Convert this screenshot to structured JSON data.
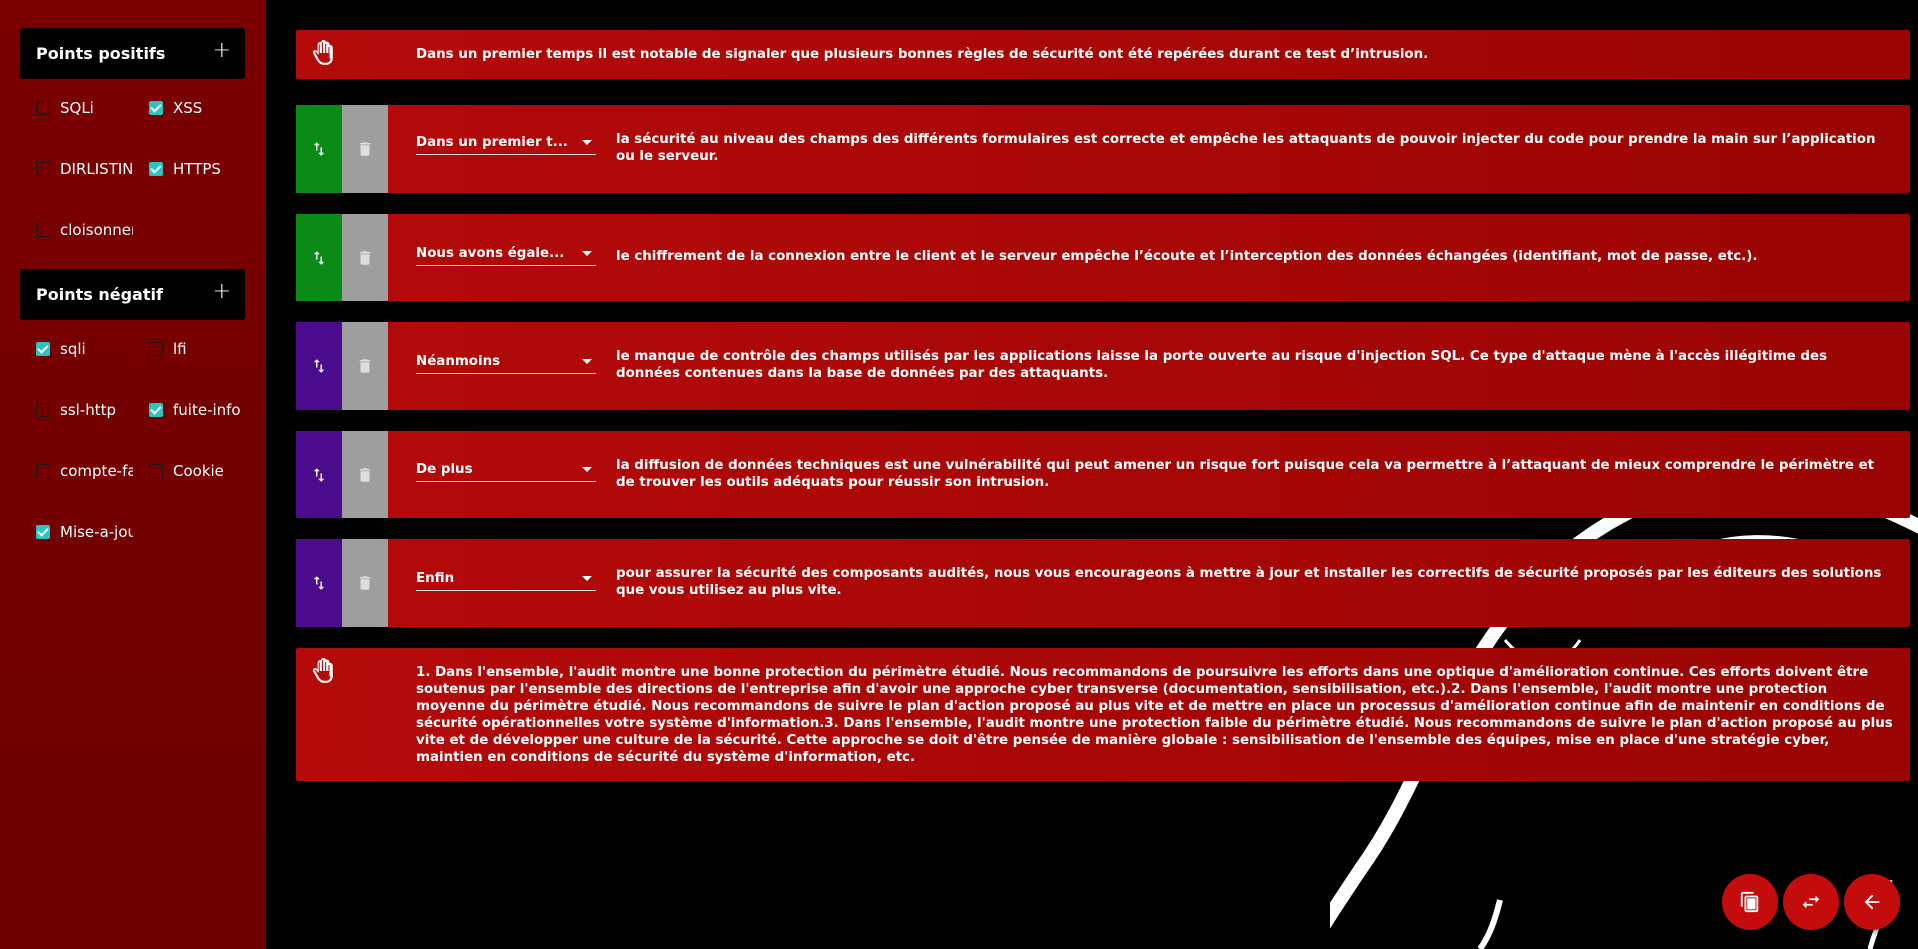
{
  "sidebar": {
    "positive": {
      "title": "Points positifs",
      "add_label": "+",
      "items": [
        {
          "label": "SQLi",
          "checked": false
        },
        {
          "label": "XSS",
          "checked": true
        },
        {
          "label": "DIRLISTING",
          "checked": false
        },
        {
          "label": "HTTPS",
          "checked": true
        },
        {
          "label": "cloisonnement",
          "checked": false
        }
      ]
    },
    "negative": {
      "title": "Points négatif",
      "add_label": "+",
      "items": [
        {
          "label": "sqli",
          "checked": true
        },
        {
          "label": "lfi",
          "checked": false
        },
        {
          "label": "ssl-http",
          "checked": false
        },
        {
          "label": "fuite-info",
          "checked": true
        },
        {
          "label": "compte-faible",
          "checked": false
        },
        {
          "label": "Cookie",
          "checked": false
        },
        {
          "label": "Mise-a-jour",
          "checked": true
        }
      ]
    }
  },
  "main": {
    "intro": "Dans un premier temps il est notable de signaler que plusieurs bonnes règles de sécurité ont été repérées durant ce test d’intrusion.",
    "rows": [
      {
        "connector": "Dans un premier temps",
        "connector_display": "Dans un premier t...",
        "text": "la sécurité au niveau des champs des différents formulaires est correcte et empêche les attaquants de pouvoir injecter du code pour prendre la main sur l’application ou le serveur.",
        "kind": "positive"
      },
      {
        "connector": "Nous avons également",
        "connector_display": "Nous avons égale...",
        "text": "le chiffrement de la connexion entre le client et le serveur empêche l’écoute et l’interception des données échangées (identifiant, mot de passe, etc.).",
        "kind": "positive"
      },
      {
        "connector": "Néanmoins",
        "connector_display": "Néanmoins",
        "text": "le manque de contrôle des champs utilisés par les applications laisse la porte ouverte au risque d'injection SQL. Ce type d'attaque mène à l'accès illégitime des données contenues dans la base de données par des attaquants.",
        "kind": "negative"
      },
      {
        "connector": "De plus",
        "connector_display": "De plus",
        "text": "la diffusion de données techniques est une vulnérabilité qui peut amener un risque fort puisque cela va permettre à l’attaquant de mieux comprendre le périmètre et de trouver les outils adéquats pour réussir son intrusion.",
        "kind": "negative"
      },
      {
        "connector": "Enfin",
        "connector_display": "Enfin",
        "text": "pour assurer la sécurité des composants audités, nous vous encourageons à mettre à jour et installer les correctifs de sécurité proposés par les éditeurs des solutions que vous utilisez au plus vite.",
        "kind": "negative"
      }
    ],
    "conclusion": "1. Dans l'ensemble, l'audit montre une bonne protection du périmètre étudié. Nous recommandons de poursuivre les efforts dans une optique d'amélioration continue. Ces efforts doivent être soutenus par l'ensemble des directions de l'entreprise afin d'avoir une approche cyber transverse (documentation, sensibilisation, etc.).2. Dans l'ensemble, l'audit montre une protection moyenne du périmètre étudié. Nous recommandons de suivre le plan d'action proposé au plus vite et de mettre en place un processus d'amélioration continue afin de maintenir en conditions de sécurité opérationnelles votre système d'information.3. Dans l'ensemble, l'audit montre une protection faible du périmètre étudié. Nous recommandons de suivre le plan d'action proposé au plus vite et de développer une culture de la sécurité. Cette approche se doit d'être pensée de manière globale : sensibilisation de l'ensemble des équipes, mise en place d'une stratégie cyber, maintien en conditions de sécurité du système d'information, etc."
  },
  "colors": {
    "positive": "#0b8a17",
    "negative": "#4a0c8c",
    "delete": "#9e9e9e",
    "accent": "#c40c0c",
    "checkbox": "#2bc4c4"
  },
  "icons": {
    "intro": "hand-icon",
    "move": "swap-vertical-icon",
    "delete": "trash-icon",
    "fab_copy": "copy-icon",
    "fab_swap": "swap-horizontal-icon",
    "fab_back": "arrow-back-icon"
  }
}
